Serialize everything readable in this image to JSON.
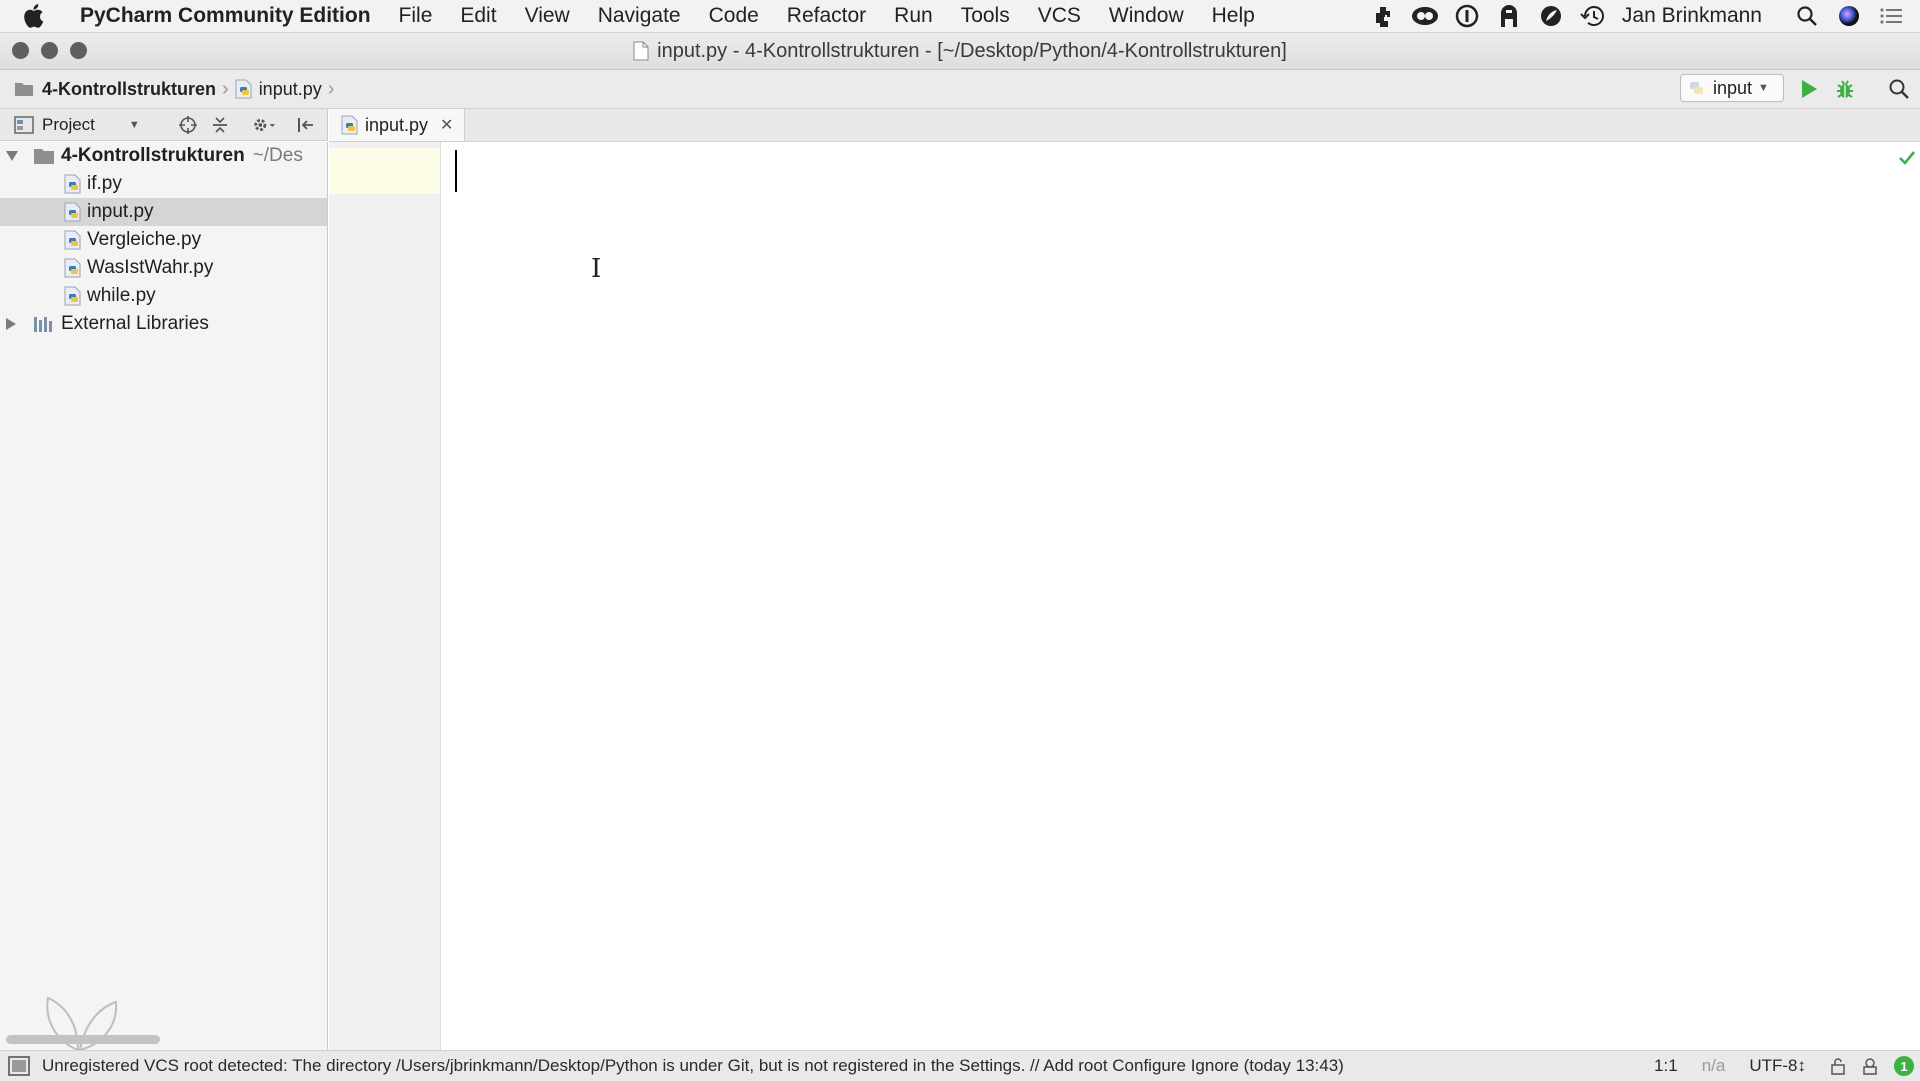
{
  "menubar": {
    "app_name": "PyCharm Community Edition",
    "items": [
      "File",
      "Edit",
      "View",
      "Navigate",
      "Code",
      "Refactor",
      "Run",
      "Tools",
      "VCS",
      "Window",
      "Help"
    ],
    "user_name": "Jan Brinkmann"
  },
  "window": {
    "title": "input.py - 4-Kontrollstrukturen - [~/Desktop/Python/4-Kontrollstrukturen]"
  },
  "navbar": {
    "breadcrumb_project": "4-Kontrollstrukturen",
    "breadcrumb_file": "input.py",
    "run_config": "input"
  },
  "project_panel": {
    "view_label": "Project",
    "root_name": "4-Kontrollstrukturen",
    "root_path": "~/Des",
    "files": [
      "if.py",
      "input.py",
      "Vergleiche.py",
      "WasIstWahr.py",
      "while.py"
    ],
    "selected_file": "input.py",
    "external_libraries": "External Libraries"
  },
  "editor": {
    "tab_label": "input.py",
    "cursor_position": "1:1"
  },
  "statusbar": {
    "message": "Unregistered VCS root detected: The directory /Users/jbrinkmann/Desktop/Python is under Git, but is not registered in the Settings. // Add root  Configure  Ignore (today 13:43)",
    "position": "1:1",
    "line_separator": "n/a",
    "encoding": "UTF-8↕",
    "event_count": "1"
  },
  "colors": {
    "run_green": "#3cb043",
    "selection_gray": "#d5d5d5",
    "current_line_yellow": "#fdfce6"
  }
}
